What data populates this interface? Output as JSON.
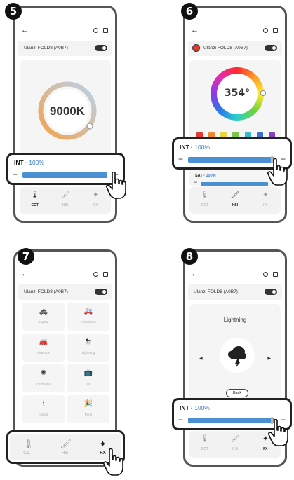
{
  "common": {
    "device_name": "Ulanzi FOLD8 (A0B7)",
    "back_glyph": "←",
    "int_label": "INT · ",
    "int_value": "100%",
    "int_level": 1.0,
    "minus": "−",
    "plus": "+",
    "tabs": [
      {
        "label": "CCT",
        "icon": "thermometer-icon"
      },
      {
        "label": "HSI",
        "icon": "brush-icon"
      },
      {
        "label": "FX",
        "icon": "magic-wand-icon"
      }
    ]
  },
  "steps": {
    "s5": "5",
    "s6": "6",
    "s7": "7",
    "s8": "8"
  },
  "cct": {
    "value": "9000K",
    "active_tab": "CCT",
    "gauge_colors": [
      "#f3a24b",
      "#9fc3ea"
    ]
  },
  "hsi": {
    "hue": "354°",
    "active_tab": "HSI",
    "swatches": [
      "#e53935",
      "#ef8a2a",
      "#e8d53a",
      "#7cc44a",
      "#35b9c9",
      "#3a6fd0",
      "#8a3fc2"
    ],
    "sat_label": "SAT · ",
    "sat_value": "100%",
    "sat_level": 1.0
  },
  "fx": {
    "active_tab": "FX",
    "effects": [
      {
        "label": "CopCar",
        "icon": "police-icon"
      },
      {
        "label": "Ambulance",
        "icon": "ambulance-icon"
      },
      {
        "label": "Firetruck",
        "icon": "firetruck-icon"
      },
      {
        "label": "Lightning",
        "icon": "lightning-icon"
      },
      {
        "label": "Fireworks",
        "icon": "fireworks-icon"
      },
      {
        "label": "TV",
        "icon": "tv-icon"
      },
      {
        "label": "Candle",
        "icon": "candle-icon"
      },
      {
        "label": "Party",
        "icon": "party-icon"
      }
    ]
  },
  "effect_detail": {
    "title": "Lightning",
    "back_button": "Back",
    "prev_glyph": "◀",
    "next_glyph": "▶"
  },
  "colors": {
    "accent": "#4a90d2",
    "text_accent": "#3a7cc4",
    "panel": "#f5f5f5"
  }
}
